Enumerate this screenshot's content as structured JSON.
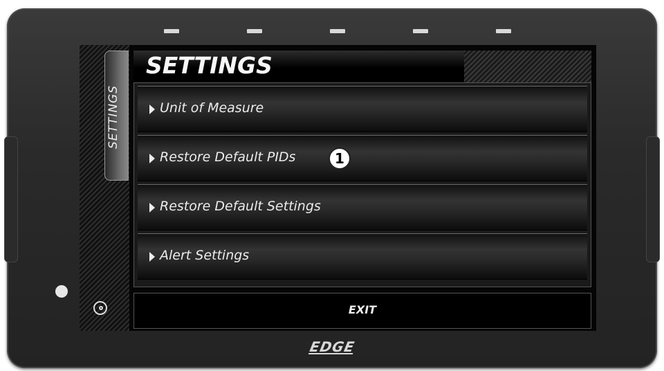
{
  "screen": {
    "title": "SETTINGS",
    "side_tab_label": "SETTINGS",
    "menu": [
      {
        "label": "Unit of Measure"
      },
      {
        "label": "Restore Default PIDs"
      },
      {
        "label": "Restore Default Settings"
      },
      {
        "label": "Alert Settings"
      }
    ],
    "exit_label": "EXIT",
    "callout_number": "1"
  },
  "device": {
    "brand": "EDGE"
  },
  "icons": {
    "menu_arrow": "triangle-right-icon",
    "gauge": "gauge-icon"
  },
  "colors": {
    "screen_bg": "#050505",
    "bezel": "#2a2a2a",
    "text": "#ececec"
  }
}
